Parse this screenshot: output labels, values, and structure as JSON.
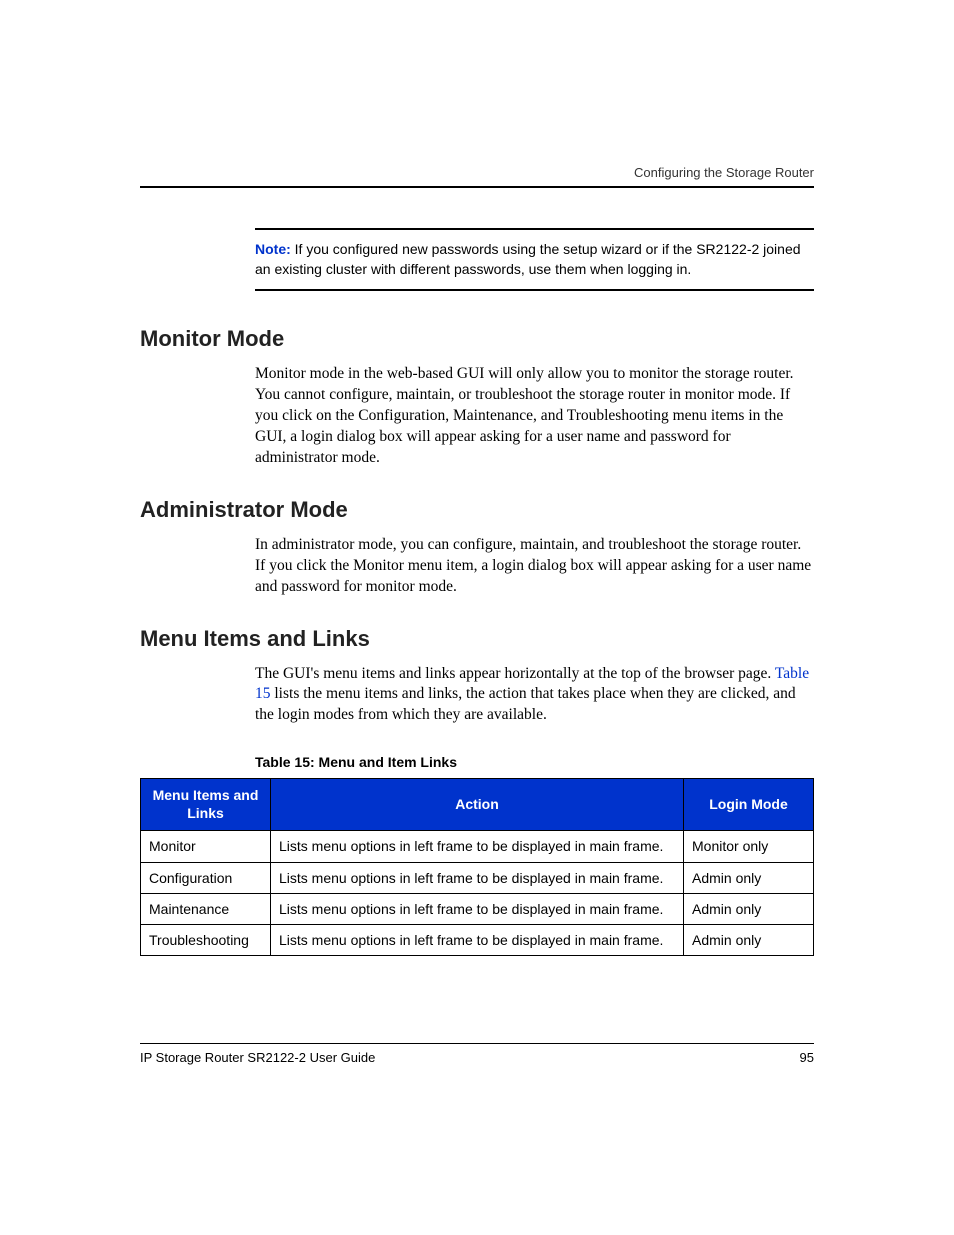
{
  "header": {
    "running_title": "Configuring the Storage Router"
  },
  "note": {
    "label": "Note:",
    "text": "If you configured new passwords using the setup wizard or if the SR2122-2 joined an existing cluster with different passwords, use them when logging in."
  },
  "sections": {
    "monitor": {
      "heading": "Monitor Mode",
      "body": "Monitor mode in the web-based GUI will only allow you to monitor the storage router. You cannot configure, maintain, or troubleshoot the storage router in monitor mode. If you click on the Configuration, Maintenance, and Troubleshooting menu items in the GUI, a login dialog box will appear asking for a user name and password for administrator mode."
    },
    "admin": {
      "heading": "Administrator Mode",
      "body": "In administrator mode, you can configure, maintain, and troubleshoot the storage router. If you click the Monitor menu item, a login dialog box will appear asking for a user name and password for monitor mode."
    },
    "menu": {
      "heading": "Menu Items and Links",
      "body_before": "The GUI's menu items and links appear horizontally at the top of the browser page. ",
      "link_text": "Table 15",
      "body_after": " lists the menu items and links, the action that takes place when they are clicked, and the login modes from which they are available."
    }
  },
  "table": {
    "caption": "Table 15:  Menu and Item Links",
    "headers": {
      "col1": "Menu Items and Links",
      "col2": "Action",
      "col3": "Login Mode"
    },
    "rows": [
      {
        "menu": "Monitor",
        "action": "Lists menu options in left frame to be displayed in main frame.",
        "mode": "Monitor only"
      },
      {
        "menu": "Configuration",
        "action": "Lists menu options in left frame to be displayed in main frame.",
        "mode": "Admin only"
      },
      {
        "menu": "Maintenance",
        "action": "Lists menu options in left frame to be displayed in main frame.",
        "mode": "Admin only"
      },
      {
        "menu": "Troubleshooting",
        "action": "Lists menu options in left frame to be displayed in main frame.",
        "mode": "Admin only"
      }
    ]
  },
  "footer": {
    "doc_title": "IP Storage Router SR2122-2 User Guide",
    "page_number": "95"
  }
}
